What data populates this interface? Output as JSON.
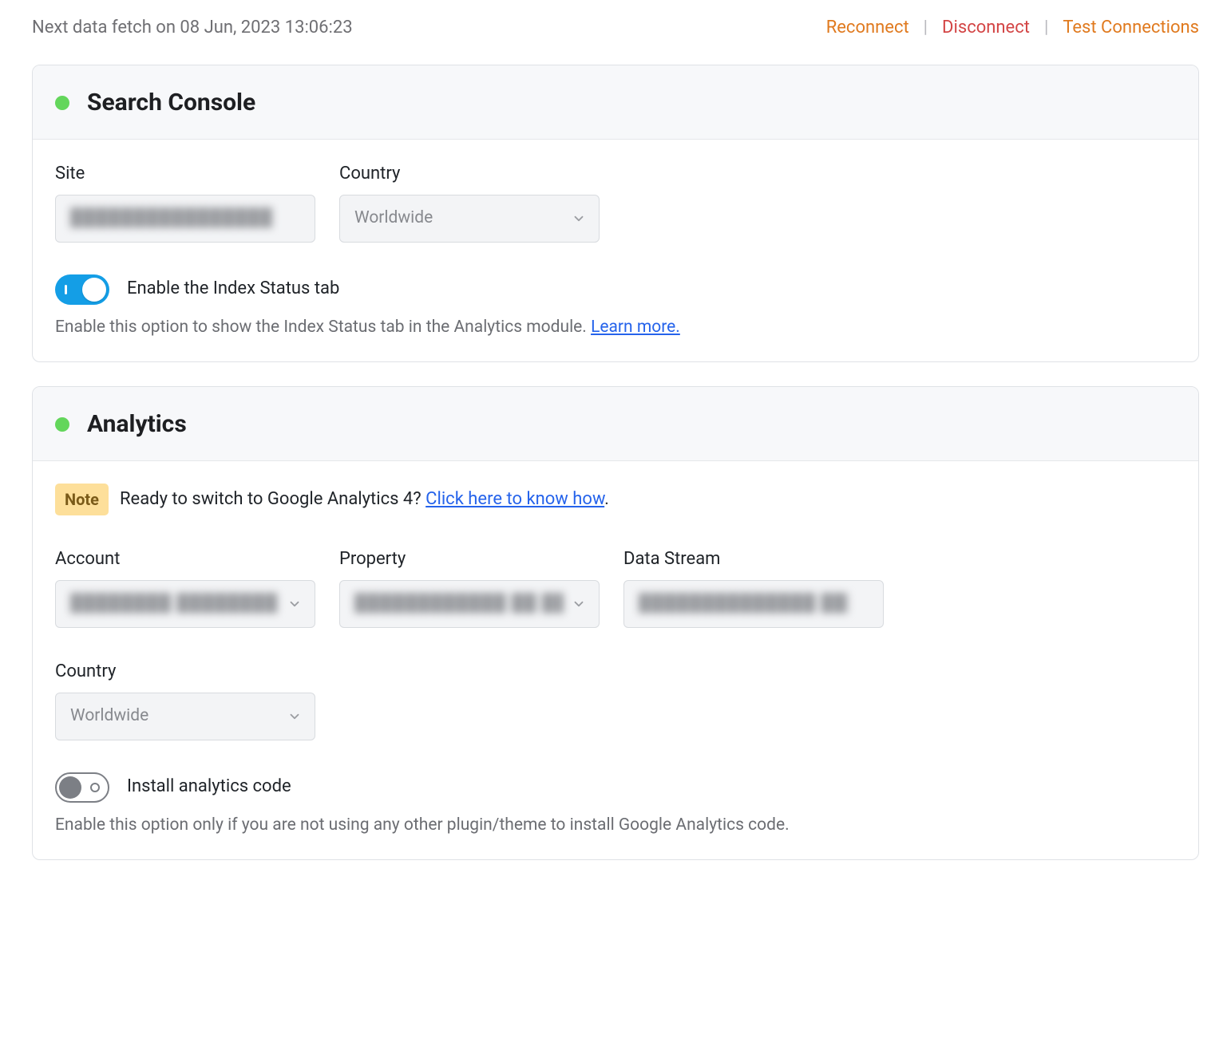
{
  "header": {
    "fetch_text": "Next data fetch on 08 Jun, 2023 13:06:23",
    "reconnect": "Reconnect",
    "disconnect": "Disconnect",
    "test_connections": "Test Connections"
  },
  "search_console": {
    "title": "Search Console",
    "site_label": "Site",
    "site_value": "████████████████",
    "country_label": "Country",
    "country_value": "Worldwide",
    "index_toggle_label": "Enable the Index Status tab",
    "index_toggle_on": true,
    "index_help": "Enable this option to show the Index Status tab in the Analytics module. ",
    "learn_more": "Learn more."
  },
  "analytics": {
    "title": "Analytics",
    "note_badge": "Note",
    "note_text": "Ready to switch to Google Analytics 4? ",
    "note_link": "Click here to know how",
    "note_period": ".",
    "account_label": "Account",
    "account_value": "████████ ████████",
    "property_label": "Property",
    "property_value": "████████████ ██ ███",
    "datastream_label": "Data Stream",
    "datastream_value": "██████████████ ████",
    "country_label": "Country",
    "country_value": "Worldwide",
    "install_toggle_label": "Install analytics code",
    "install_toggle_on": false,
    "install_help": "Enable this option only if you are not using any other plugin/theme to install Google Analytics code."
  }
}
